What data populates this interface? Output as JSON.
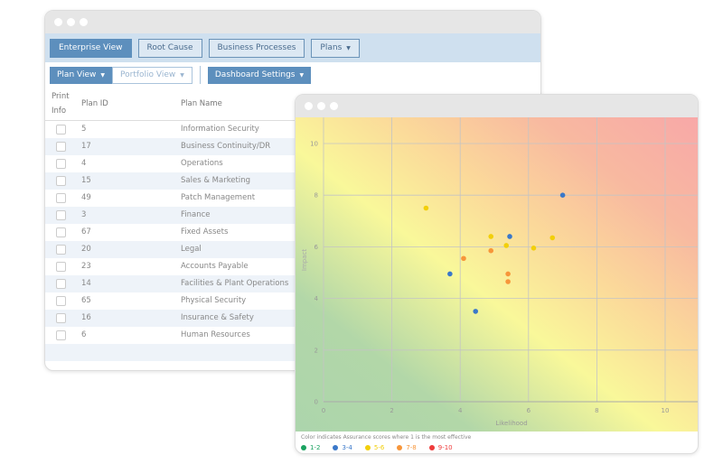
{
  "nav": {
    "buttons": [
      {
        "label": "Enterprise View",
        "active": true
      },
      {
        "label": "Root Cause",
        "active": false
      },
      {
        "label": "Business Processes",
        "active": false
      },
      {
        "label": "Plans",
        "active": false,
        "dropdown": true
      }
    ]
  },
  "toolbar": {
    "plan_view": "Plan View",
    "portfolio_view": "Portfolio View",
    "dashboard_settings": "Dashboard Settings"
  },
  "table": {
    "headers": {
      "print_line1": "Print",
      "print_line2": "Info",
      "plan_id": "Plan ID",
      "plan_name": "Plan Name"
    },
    "rows": [
      {
        "id": "5",
        "name": "Information Security"
      },
      {
        "id": "17",
        "name": "Business Continuity/DR"
      },
      {
        "id": "4",
        "name": "Operations"
      },
      {
        "id": "15",
        "name": "Sales & Marketing"
      },
      {
        "id": "49",
        "name": "Patch Management"
      },
      {
        "id": "3",
        "name": "Finance"
      },
      {
        "id": "67",
        "name": "Fixed Assets"
      },
      {
        "id": "20",
        "name": "Legal"
      },
      {
        "id": "23",
        "name": "Accounts Payable"
      },
      {
        "id": "14",
        "name": "Facilities & Plant Operations"
      },
      {
        "id": "65",
        "name": "Physical Security"
      },
      {
        "id": "16",
        "name": "Insurance & Safety"
      },
      {
        "id": "6",
        "name": "Human Resources"
      }
    ]
  },
  "chart_data": {
    "type": "scatter",
    "xlabel": "Likelihood",
    "ylabel": "Impact",
    "xlim": [
      0,
      10.6
    ],
    "ylim": [
      0,
      10.4
    ],
    "xticks": [
      0,
      2,
      4,
      6,
      8,
      10
    ],
    "yticks": [
      0,
      2,
      4,
      6,
      8,
      10
    ],
    "grid": true,
    "background": "risk heat gradient green (bottom-left) to red (top-right)",
    "legend_note": "Color indicates Assurance scores where 1 is the most effective",
    "legend_placement": "bottom",
    "legend": [
      {
        "label": "1-2",
        "color": "#1aa260"
      },
      {
        "label": "3-4",
        "color": "#3a78c9"
      },
      {
        "label": "5-6",
        "color": "#f2cf0a"
      },
      {
        "label": "7-8",
        "color": "#f7963a"
      },
      {
        "label": "9-10",
        "color": "#ee3b3b"
      }
    ],
    "points": [
      {
        "x": 3.0,
        "y": 7.5,
        "score": "5-6"
      },
      {
        "x": 7.0,
        "y": 8.0,
        "score": "3-4"
      },
      {
        "x": 4.9,
        "y": 6.4,
        "score": "5-6"
      },
      {
        "x": 5.45,
        "y": 6.4,
        "score": "3-4"
      },
      {
        "x": 5.35,
        "y": 6.05,
        "score": "5-6"
      },
      {
        "x": 6.15,
        "y": 5.95,
        "score": "5-6"
      },
      {
        "x": 6.7,
        "y": 6.35,
        "score": "5-6"
      },
      {
        "x": 4.9,
        "y": 5.85,
        "score": "7-8"
      },
      {
        "x": 4.1,
        "y": 5.55,
        "score": "7-8"
      },
      {
        "x": 3.7,
        "y": 4.95,
        "score": "3-4"
      },
      {
        "x": 5.4,
        "y": 4.95,
        "score": "7-8"
      },
      {
        "x": 5.4,
        "y": 4.65,
        "score": "7-8"
      },
      {
        "x": 4.45,
        "y": 3.5,
        "score": "3-4"
      }
    ]
  }
}
